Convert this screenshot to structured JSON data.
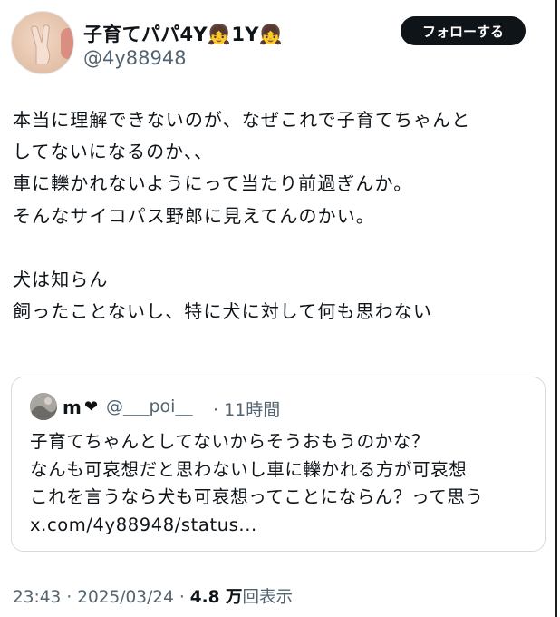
{
  "author": {
    "display_name": "子育てパパ4Y👧1Y👧",
    "handle": "@4y88948"
  },
  "follow_button": {
    "label": "フォローする"
  },
  "tweet": {
    "text": "本当に理解できないのが、なぜこれで子育てちゃんと\nしてないになるのか、、\n車に轢かれないようにって当たり前過ぎんか。\nそんなサイコパス野郎に見えてんのかい。\n\n犬は知らん\n飼ったことないし、特に犬に対して何も思わない"
  },
  "quoted_tweet": {
    "name": "m",
    "heart": "❤",
    "handle": "@___poi__",
    "time": "· 11時間",
    "text": "子育てちゃんとしてないからそうおもうのかな？\nなんも可哀想だと思わないし車に轢かれる方が可哀想\nこれを言うなら犬も可哀想ってことにならん？って思う\nx.com/4y88948/status..."
  },
  "meta": {
    "time": "23:43",
    "separator": "·",
    "date": "2025/03/24",
    "views_count": "4.8 万",
    "views_label": "回表示"
  }
}
